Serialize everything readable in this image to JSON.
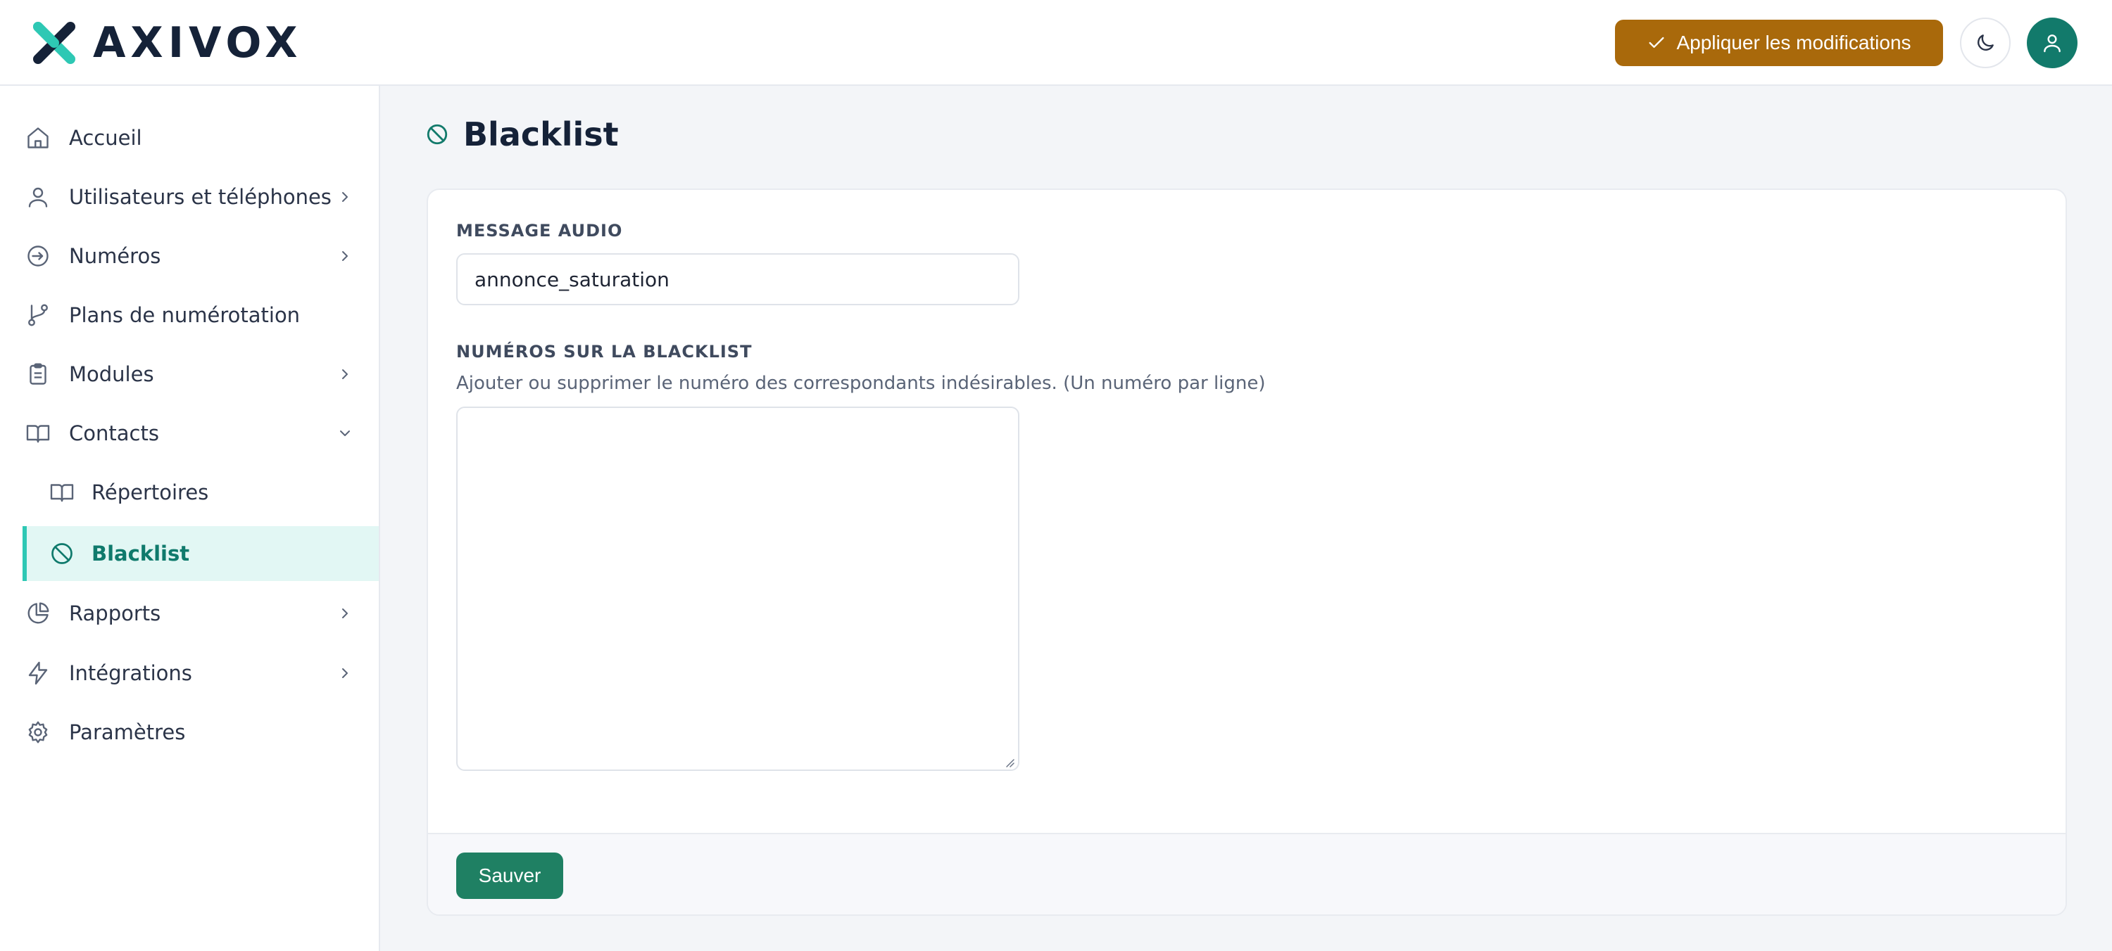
{
  "header": {
    "logo_text": "AXIVOX",
    "apply_button_label": "Appliquer les modifications",
    "apply_button_icon": "check-icon",
    "theme_toggle_icon": "moon-icon",
    "avatar_icon": "user-icon"
  },
  "colors": {
    "accent": "#127a6b",
    "apply_button": "#a9690b",
    "save_button": "#1f8063",
    "active_nav_bg": "#e2f7f4",
    "active_nav_border": "#2ec8b4"
  },
  "sidebar": {
    "items": [
      {
        "label": "Accueil",
        "icon": "home-icon",
        "chevron": "none"
      },
      {
        "label": "Utilisateurs et téléphones",
        "icon": "user-icon",
        "chevron": "right"
      },
      {
        "label": "Numéros",
        "icon": "arrow-circle-icon",
        "chevron": "right"
      },
      {
        "label": "Plans de numérotation",
        "icon": "git-branch-icon",
        "chevron": "none"
      },
      {
        "label": "Modules",
        "icon": "clipboard-icon",
        "chevron": "right"
      },
      {
        "label": "Contacts",
        "icon": "book-open-icon",
        "chevron": "down"
      },
      {
        "label": "Répertoires",
        "icon": "book-open-icon",
        "chevron": "none",
        "sub": true
      },
      {
        "label": "Blacklist",
        "icon": "ban-icon",
        "chevron": "none",
        "sub": true,
        "active": true
      },
      {
        "label": "Rapports",
        "icon": "pie-chart-icon",
        "chevron": "right"
      },
      {
        "label": "Intégrations",
        "icon": "lightning-icon",
        "chevron": "right"
      },
      {
        "label": "Paramètres",
        "icon": "gear-icon",
        "chevron": "none"
      }
    ]
  },
  "main": {
    "title": "Blacklist",
    "title_icon": "ban-icon",
    "audio_message": {
      "label": "MESSAGE AUDIO",
      "value": "annonce_saturation"
    },
    "blacklist_numbers": {
      "label": "NUMÉROS SUR LA BLACKLIST",
      "help": "Ajouter ou supprimer le numéro des correspondants indésirables. (Un numéro par ligne)",
      "value": ""
    },
    "save_label": "Sauver"
  }
}
